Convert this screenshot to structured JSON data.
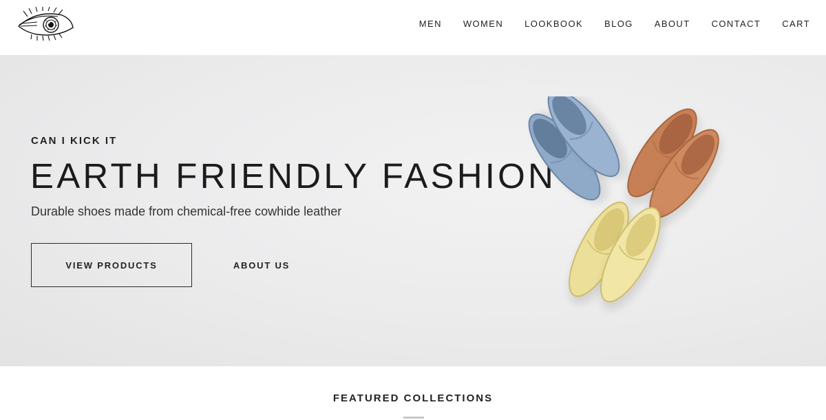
{
  "nav": {
    "items": [
      "MEN",
      "WOMEN",
      "LOOKBOOK",
      "BLOG",
      "ABOUT",
      "CONTACT",
      "CART"
    ]
  },
  "hero": {
    "eyebrow": "CAN I KICK IT",
    "title": "EARTH FRIENDLY FASHION",
    "subtitle": "Durable shoes made from chemical-free cowhide leather",
    "primary_button": "VIEW PRODUCTS",
    "secondary_button": "ABOUT US",
    "shoe_colors": {
      "blue": "#8fa9c8",
      "tan": "#c77f55",
      "yellow": "#ecdf99"
    }
  },
  "featured": {
    "title": "FEATURED COLLECTIONS"
  },
  "icons": {
    "logo": "eye-logo-icon"
  }
}
